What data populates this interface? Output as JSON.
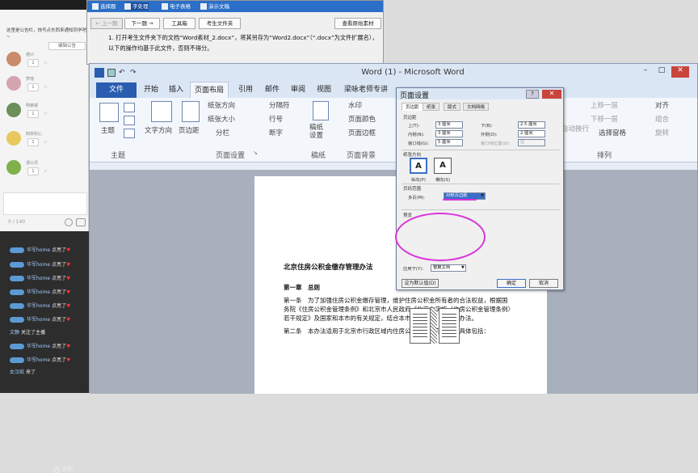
{
  "chat": {
    "notice": "这里是公告栏，快写点东西来通知同学吧~",
    "edit_notice": "编辑公告",
    "users": [
      {
        "name": "德兴",
        "count": "1",
        "avatar_color": "#c98b6c"
      },
      {
        "name": "梦瑶",
        "count": "1",
        "avatar_color": "#d4a5b0"
      },
      {
        "name": "明荣镜",
        "count": "1",
        "avatar_color": "#6b8e5a"
      },
      {
        "name": "知依初心",
        "count": "1",
        "avatar_color": "#e8c85c"
      },
      {
        "name": "漫公讯",
        "count": "1",
        "avatar_color": "#7eb04c"
      }
    ],
    "counter": "0 / 140",
    "help": "求助",
    "messages": [
      {
        "user": "华军home",
        "text": "点亮了"
      },
      {
        "user": "华军home",
        "text": "点亮了"
      },
      {
        "user": "华军home",
        "text": "点亮了"
      },
      {
        "user": "华军home",
        "text": "点亮了"
      },
      {
        "user": "华军home",
        "text": "点亮了"
      },
      {
        "user": "华军home",
        "text": "点亮了"
      }
    ],
    "follow_user": "文静",
    "follow_text": "关注了主播",
    "messages2": [
      {
        "user": "华军home",
        "text": "点亮了"
      },
      {
        "user": "华军home",
        "text": "点亮了"
      }
    ],
    "last_user": "女汉纸",
    "last_text": "来了"
  },
  "exam": {
    "tabs": [
      "选择题",
      "字处理",
      "电子表格",
      "演示文稿"
    ],
    "prev": "← 上一题",
    "next": "下一题 →",
    "toolbox": "工具箱",
    "folder": "考生文件夹",
    "view_source": "查看原始素材",
    "instruction": "1. 打开考生文件夹下的文档“Word素材_2.docx”，将其另存为“Word2.docx”（“.docx”为文件扩展名），以下的操作均基于此文件，否则不得分。"
  },
  "word": {
    "title": "Word (1) - Microsoft Word",
    "file": "文件",
    "tabs": [
      "开始",
      "插入",
      "页面布局",
      "引用",
      "邮件",
      "审阅",
      "视图",
      "梁咏老师专讲"
    ],
    "active_tab": "页面布局",
    "ribbon": {
      "theme": "主题",
      "text_direction": "文字方向",
      "margins": "页边距",
      "orientation": "纸张方向",
      "size": "纸张大小",
      "columns": "分栏",
      "breaks": "分隔符",
      "line_numbers": "行号",
      "hyphenation": "断字",
      "draft": "稿纸设置",
      "watermark": "水印",
      "page_color": "页面颜色",
      "page_border": "页面边框",
      "bring_forward": "上移一层",
      "send_backward": "下移一层",
      "selection_pane": "选择窗格",
      "align": "对齐",
      "group": "组合",
      "rotate": "旋转",
      "auto_wrap": "自动换行",
      "group_theme": "主题",
      "group_page_setup": "页面设置",
      "group_draft": "稿纸",
      "group_page_bg": "页面背景",
      "group_arrange": "排列"
    },
    "doc": {
      "title": "北京住房公积金缴存管理办法",
      "chapter": "第一章　总则",
      "art1_l1": "第一条　为了加强住房公积金缴存管理，维护住房公积金所有者的合法权益，根据国",
      "art1_l2": "务院《住房公积金管理条例》和北京市人民政府《北京市实施〈住房公积金管理条例〉",
      "art1_l3": "若干规定》及国家和本市的有关规定，结合本市实际情况，制定本办法。",
      "art2": "第二条　本办法适用于北京市行政区域内住房公积金的缴存管理，具体包括："
    }
  },
  "dialog": {
    "title": "页面设置",
    "tabs": [
      "页边距",
      "纸张",
      "版式",
      "文档网格"
    ],
    "margins_section": "页边距",
    "top_label": "上(T):",
    "top_value": "3 厘米",
    "bottom_label": "下(B):",
    "bottom_value": "2.5 厘米",
    "inner_label": "内侧(N):",
    "inner_value": "3 厘米",
    "outer_label": "外侧(O):",
    "outer_value": "2 厘米",
    "gutter_label": "装订线(G):",
    "gutter_value": "5 厘米",
    "gutter_pos_label": "装订线位置(U):",
    "gutter_pos_value": "左",
    "orientation_section": "纸张方向",
    "portrait": "纵向(P)",
    "landscape": "横向(S)",
    "pages_section": "页码范围",
    "multiple_pages_label": "多页(M):",
    "multiple_pages_value": "对称页边距",
    "preview_section": "预览",
    "apply_to_label": "应用于(Y):",
    "apply_to_value": "整篇文档",
    "default_button": "设为默认值(D)",
    "ok": "确定",
    "cancel": "取消"
  }
}
